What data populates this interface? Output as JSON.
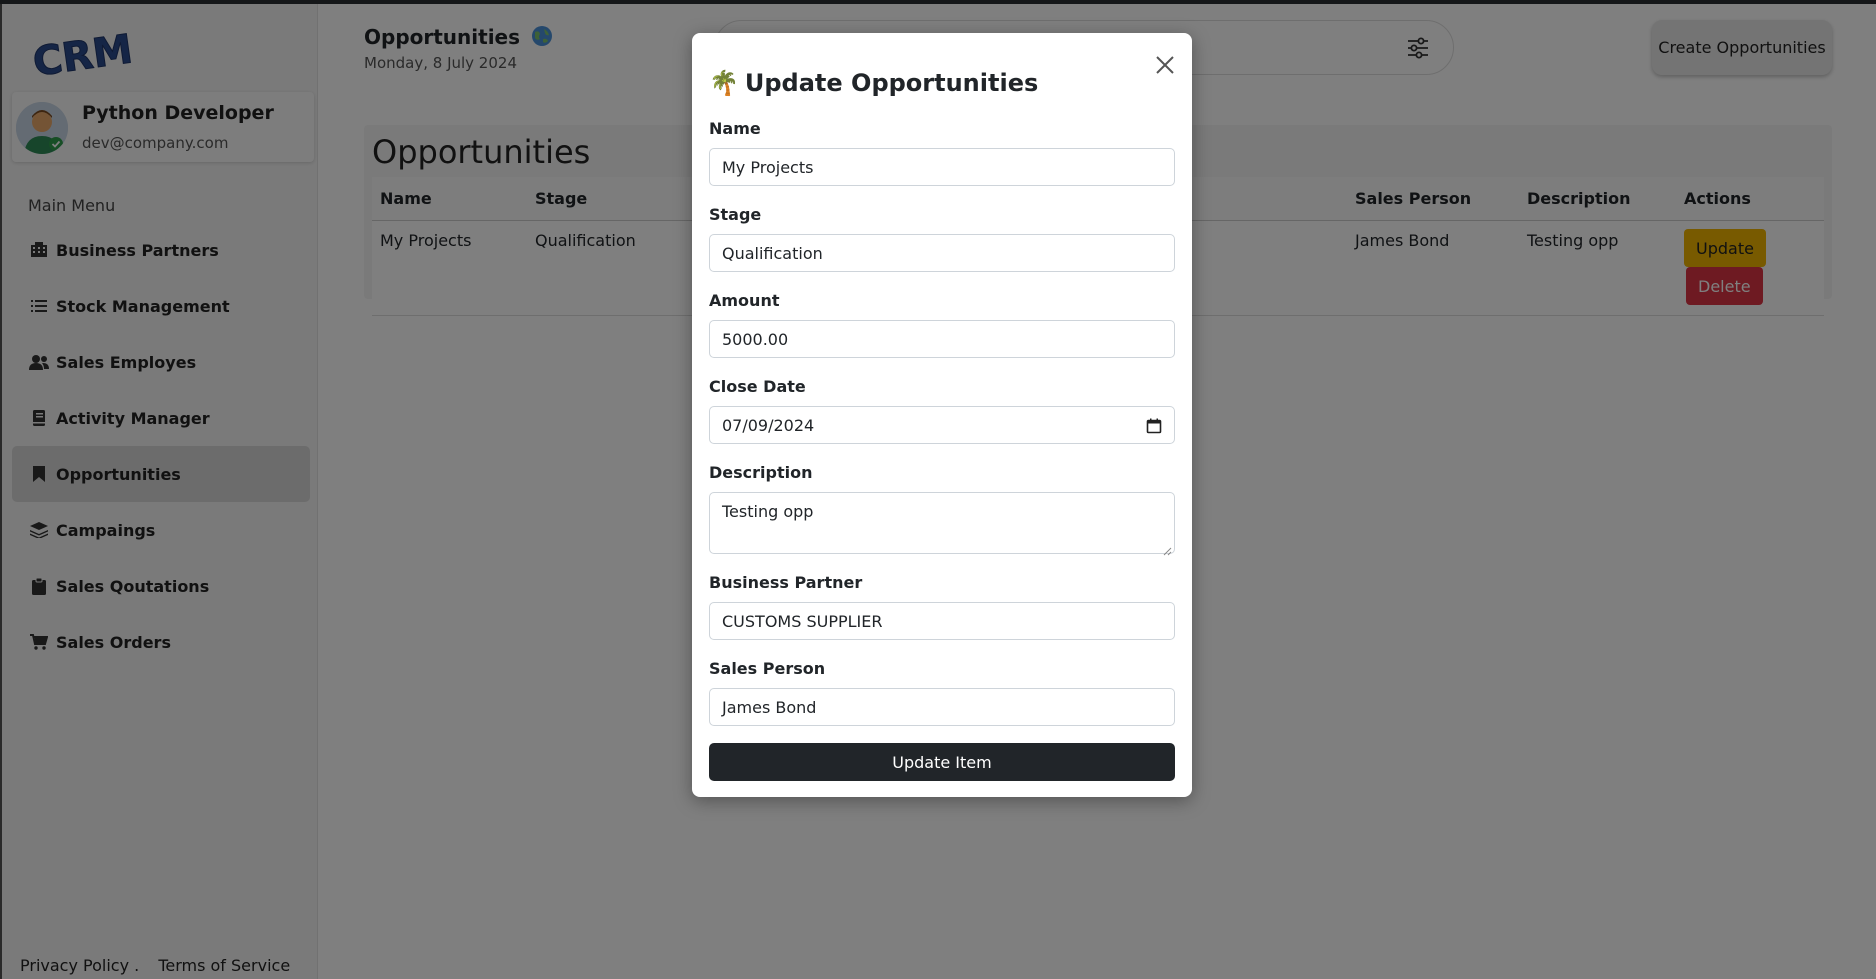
{
  "app": {
    "logo_text": "CRM"
  },
  "user": {
    "name": "Python Developer",
    "email": "dev@company.com"
  },
  "sidebar": {
    "menu_title": "Main Menu",
    "items": [
      {
        "label": "Business Partners",
        "icon": "building-icon",
        "active": false
      },
      {
        "label": "Stock Management",
        "icon": "list-icon",
        "active": false
      },
      {
        "label": "Sales Employes",
        "icon": "users-icon",
        "active": false
      },
      {
        "label": "Activity Manager",
        "icon": "book-icon",
        "active": false
      },
      {
        "label": "Opportunities",
        "icon": "bookmark-icon",
        "active": true
      },
      {
        "label": "Campaings",
        "icon": "layers-icon",
        "active": false
      },
      {
        "label": "Sales Qoutations",
        "icon": "clipboard-icon",
        "active": false
      },
      {
        "label": "Sales Orders",
        "icon": "cart-icon",
        "active": false
      }
    ],
    "footer": {
      "privacy": "Privacy Policy .",
      "terms": "Terms of Service"
    }
  },
  "header": {
    "title": "Opportunities",
    "title_icon": "globe-icon",
    "date": "Monday, 8 July 2024",
    "create_button": "Create Opportunities"
  },
  "content": {
    "title": "Opportunities",
    "columns": [
      "Name",
      "Stage",
      "Sales Person",
      "Description",
      "Actions"
    ],
    "rows": [
      {
        "name": "My Projects",
        "stage": "Qualification",
        "sales_person": "James Bond",
        "description": "Testing opp",
        "update": "Update",
        "delete": "Delete"
      }
    ]
  },
  "modal": {
    "title": "Update Opportunities",
    "title_icon": "palm-tree-icon",
    "fields": {
      "name": {
        "label": "Name",
        "value": "My Projects"
      },
      "stage": {
        "label": "Stage",
        "value": "Qualification"
      },
      "amount": {
        "label": "Amount",
        "value": "5000.00"
      },
      "close_date": {
        "label": "Close Date",
        "value": "07/09/2024"
      },
      "description": {
        "label": "Description",
        "value": "Testing opp"
      },
      "business_partner": {
        "label": "Business Partner",
        "value": "CUSTOMS SUPPLIER"
      },
      "sales_person": {
        "label": "Sales Person",
        "value": "James Bond"
      }
    },
    "submit": "Update Item"
  },
  "colors": {
    "update_button": "#f0b400",
    "delete_button": "#dc3545",
    "submit_button": "#212529",
    "logo": "#2b4a8c"
  }
}
